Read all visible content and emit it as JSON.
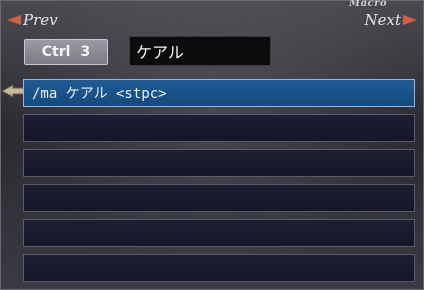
{
  "window": {
    "title": "Macro"
  },
  "nav": {
    "prev_label": "Prev",
    "next_label": "Next"
  },
  "set": {
    "modifier": "Ctrl",
    "slot": "3"
  },
  "macro": {
    "name": "ケアル"
  },
  "lines": [
    {
      "text": "/ma ケアル <stpc>",
      "selected": true
    },
    {
      "text": "",
      "selected": false
    },
    {
      "text": "",
      "selected": false
    },
    {
      "text": "",
      "selected": false
    },
    {
      "text": "",
      "selected": false
    },
    {
      "text": "",
      "selected": false
    }
  ],
  "colors": {
    "accent_arrow": "#d65c45",
    "selected_line": "#1d5b96",
    "line_bg": "#1a1a30"
  }
}
